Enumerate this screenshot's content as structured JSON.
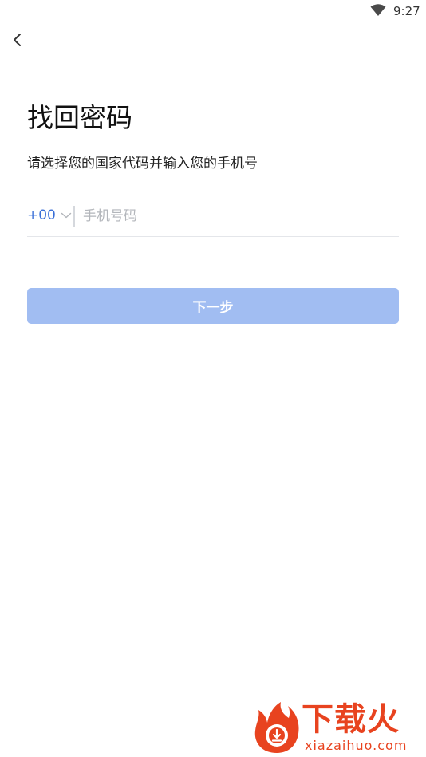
{
  "status_bar": {
    "time": "9:27",
    "wifi_icon": "wifi-icon"
  },
  "header": {
    "back_icon": "chevron-left-icon"
  },
  "main": {
    "title": "找回密码",
    "subtitle": "请选择您的国家代码并输入您的手机号",
    "country_code": "+00",
    "phone_placeholder": "手机号码",
    "next_label": "下一步"
  },
  "watermark": {
    "brand": "下载火",
    "domain": "xiazaihuo.com"
  },
  "colors": {
    "accent": "#3a6fd8",
    "button_disabled": "#a1bdf2",
    "watermark": "#e8431f"
  }
}
